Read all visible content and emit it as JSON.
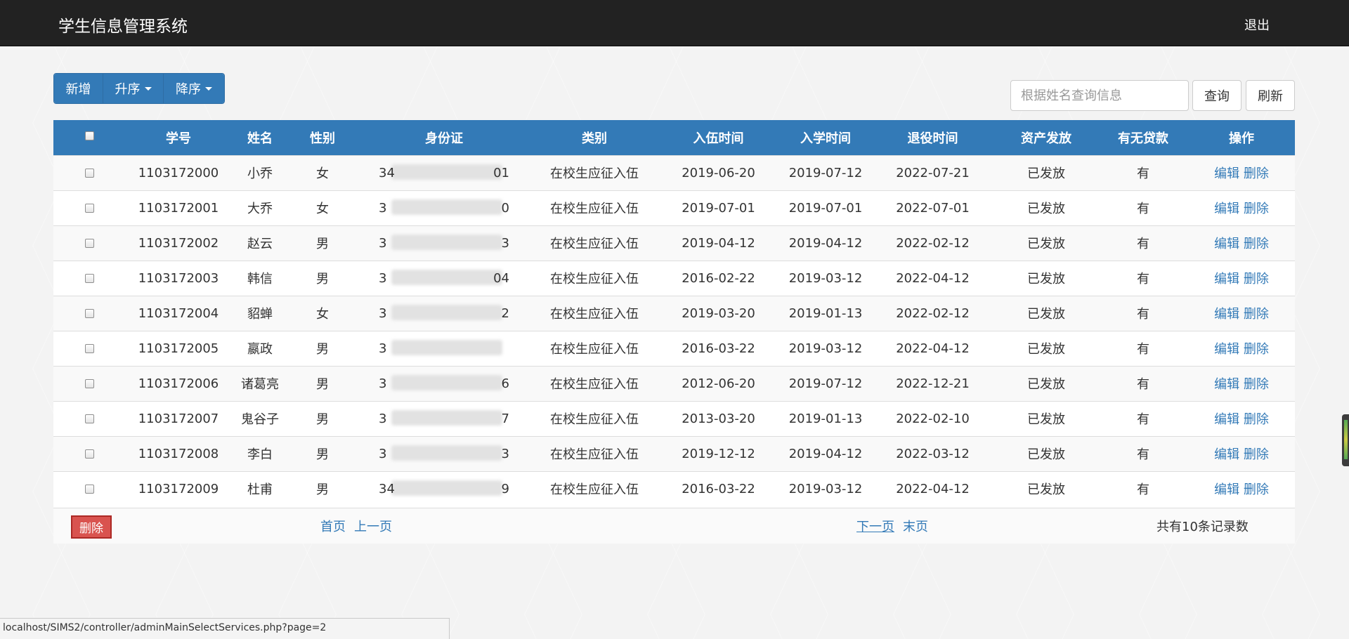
{
  "app": {
    "title": "学生信息管理系统",
    "logout": "退出"
  },
  "toolbar": {
    "add": "新增",
    "asc": "升序",
    "desc": "降序"
  },
  "search": {
    "placeholder": "根据姓名查询信息",
    "query": "查询",
    "refresh": "刷新"
  },
  "table": {
    "headers": [
      "学号",
      "姓名",
      "性别",
      "身份证",
      "类别",
      "入伍时间",
      "入学时间",
      "退役时间",
      "资产发放",
      "有无贷款",
      "操作"
    ],
    "edit_label": "编辑",
    "delete_label": "删除",
    "rows": [
      {
        "id": "1103172000",
        "name": "小乔",
        "gender": "女",
        "idcard_left": "34",
        "idcard_right": "01",
        "category": "在校生应征入伍",
        "enlist": "2019-06-20",
        "enroll": "2019-07-12",
        "retire": "2022-07-21",
        "asset": "已发放",
        "loan": "有"
      },
      {
        "id": "1103172001",
        "name": "大乔",
        "gender": "女",
        "idcard_left": "3",
        "idcard_right": "0",
        "category": "在校生应征入伍",
        "enlist": "2019-07-01",
        "enroll": "2019-07-01",
        "retire": "2022-07-01",
        "asset": "已发放",
        "loan": "有"
      },
      {
        "id": "1103172002",
        "name": "赵云",
        "gender": "男",
        "idcard_left": "3",
        "idcard_right": "3",
        "category": "在校生应征入伍",
        "enlist": "2019-04-12",
        "enroll": "2019-04-12",
        "retire": "2022-02-12",
        "asset": "已发放",
        "loan": "有"
      },
      {
        "id": "1103172003",
        "name": "韩信",
        "gender": "男",
        "idcard_left": "3",
        "idcard_right": "04",
        "category": "在校生应征入伍",
        "enlist": "2016-02-22",
        "enroll": "2019-03-12",
        "retire": "2022-04-12",
        "asset": "已发放",
        "loan": "有"
      },
      {
        "id": "1103172004",
        "name": "貂蝉",
        "gender": "女",
        "idcard_left": "3",
        "idcard_right": "2",
        "category": "在校生应征入伍",
        "enlist": "2019-03-20",
        "enroll": "2019-01-13",
        "retire": "2022-02-12",
        "asset": "已发放",
        "loan": "有"
      },
      {
        "id": "1103172005",
        "name": "嬴政",
        "gender": "男",
        "idcard_left": "3",
        "idcard_right": "",
        "category": "在校生应征入伍",
        "enlist": "2016-03-22",
        "enroll": "2019-03-12",
        "retire": "2022-04-12",
        "asset": "已发放",
        "loan": "有"
      },
      {
        "id": "1103172006",
        "name": "诸葛亮",
        "gender": "男",
        "idcard_left": "3",
        "idcard_right": "6",
        "category": "在校生应征入伍",
        "enlist": "2012-06-20",
        "enroll": "2019-07-12",
        "retire": "2022-12-21",
        "asset": "已发放",
        "loan": "有"
      },
      {
        "id": "1103172007",
        "name": "鬼谷子",
        "gender": "男",
        "idcard_left": "3",
        "idcard_right": "7",
        "category": "在校生应征入伍",
        "enlist": "2013-03-20",
        "enroll": "2019-01-13",
        "retire": "2022-02-10",
        "asset": "已发放",
        "loan": "有"
      },
      {
        "id": "1103172008",
        "name": "李白",
        "gender": "男",
        "idcard_left": "3",
        "idcard_right": "3",
        "category": "在校生应征入伍",
        "enlist": "2019-12-12",
        "enroll": "2019-04-12",
        "retire": "2022-03-12",
        "asset": "已发放",
        "loan": "有"
      },
      {
        "id": "1103172009",
        "name": "杜甫",
        "gender": "男",
        "idcard_left": "34",
        "idcard_right": "9",
        "category": "在校生应征入伍",
        "enlist": "2016-03-22",
        "enroll": "2019-03-12",
        "retire": "2022-04-12",
        "asset": "已发放",
        "loan": "有"
      }
    ]
  },
  "footer": {
    "delete": "删除",
    "first": "首页",
    "prev": "上一页",
    "next": "下一页",
    "last": "末页",
    "total": "共有10条记录数"
  },
  "statusbar": {
    "url": "localhost/SIMS2/controller/adminMainSelectServices.php?page=2"
  },
  "colors": {
    "primary": "#337ab7",
    "navbar": "#222222",
    "danger": "#d9534f"
  },
  "icons": [
    "caret-down-icon",
    "checkbox-icon"
  ]
}
